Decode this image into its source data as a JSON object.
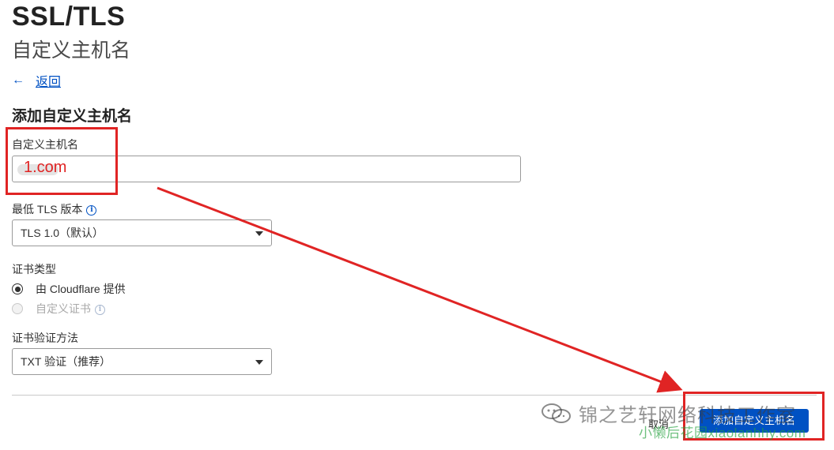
{
  "header": {
    "title": "SSL/TLS",
    "subtitle": "自定义主机名"
  },
  "back": {
    "icon": "arrow-left-icon",
    "label": "返回"
  },
  "form": {
    "heading": "添加自定义主机名",
    "hostname_label": "自定义主机名",
    "hostname_value": "1.com",
    "tls_label": "最低 TLS 版本",
    "tls_value": "TLS 1.0（默认）",
    "cert_type_label": "证书类型",
    "cert_option_1": "由 Cloudflare 提供",
    "cert_option_2": "自定义证书",
    "cert_selected": "由 Cloudflare 提供",
    "verify_label": "证书验证方法",
    "verify_value": "TXT 验证（推荐）"
  },
  "footer": {
    "cancel_label": "取消",
    "submit_label": "添加自定义主机名"
  },
  "watermark": {
    "line1": "锦之艺轩网络科技工作室",
    "line2": "小懒后花园xiaolanhhy.com"
  },
  "colors": {
    "accent": "#0051c3",
    "annotation_red": "#e02424"
  }
}
